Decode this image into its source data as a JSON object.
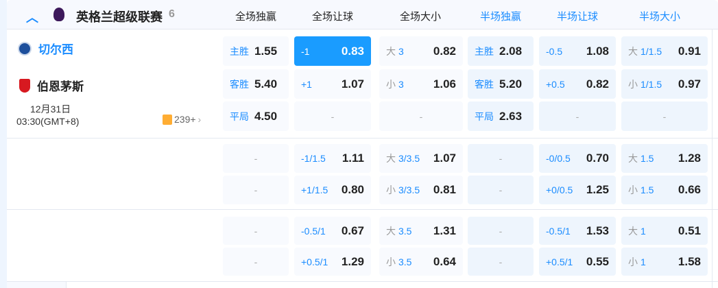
{
  "league": {
    "name": "英格兰超级联赛",
    "count": "6",
    "collapse_icon": "chevron-up-icon",
    "logo_icon": "premier-league-logo"
  },
  "columns": [
    "全场独赢",
    "全场让球",
    "全场大小",
    "半场独赢",
    "半场让球",
    "半场大小"
  ],
  "match": {
    "home": "切尔西",
    "away": "伯恩茅斯",
    "date": "12月31日",
    "time": "03:30(GMT+8)",
    "more_markets": "239+"
  },
  "colors": {
    "accent": "#1a8cff",
    "active": "#1a9cff"
  },
  "sections": [
    [
      [
        {
          "l": "主胜",
          "o": "1.55"
        },
        {
          "l": "-1",
          "o": "0.83",
          "active": true
        },
        {
          "p": "大",
          "l": "3",
          "o": "0.82"
        },
        {
          "l": "主胜",
          "o": "2.08"
        },
        {
          "l": "-0.5",
          "o": "1.08"
        },
        {
          "p": "大",
          "l": "1/1.5",
          "o": "0.91"
        }
      ],
      [
        {
          "l": "客胜",
          "o": "5.40"
        },
        {
          "l": "+1",
          "o": "1.07"
        },
        {
          "p": "小",
          "l": "3",
          "o": "1.06"
        },
        {
          "l": "客胜",
          "o": "5.20"
        },
        {
          "l": "+0.5",
          "o": "0.82"
        },
        {
          "p": "小",
          "l": "1/1.5",
          "o": "0.97"
        }
      ],
      [
        {
          "l": "平局",
          "o": "4.50"
        },
        {
          "e": "-"
        },
        {
          "e": "-"
        },
        {
          "l": "平局",
          "o": "2.63"
        },
        {
          "e": "-"
        },
        {
          "e": "-"
        }
      ]
    ],
    [
      [
        {
          "e": "-"
        },
        {
          "l": "-1/1.5",
          "o": "1.11"
        },
        {
          "p": "大",
          "l": "3/3.5",
          "o": "1.07"
        },
        {
          "e": "-"
        },
        {
          "l": "-0/0.5",
          "o": "0.70"
        },
        {
          "p": "大",
          "l": "1.5",
          "o": "1.28"
        }
      ],
      [
        {
          "e": "-"
        },
        {
          "l": "+1/1.5",
          "o": "0.80"
        },
        {
          "p": "小",
          "l": "3/3.5",
          "o": "0.81"
        },
        {
          "e": "-"
        },
        {
          "l": "+0/0.5",
          "o": "1.25"
        },
        {
          "p": "小",
          "l": "1.5",
          "o": "0.66"
        }
      ]
    ],
    [
      [
        {
          "e": "-"
        },
        {
          "l": "-0.5/1",
          "o": "0.67"
        },
        {
          "p": "大",
          "l": "3.5",
          "o": "1.31"
        },
        {
          "e": "-"
        },
        {
          "l": "-0.5/1",
          "o": "1.53"
        },
        {
          "p": "大",
          "l": "1",
          "o": "0.51"
        }
      ],
      [
        {
          "e": "-"
        },
        {
          "l": "+0.5/1",
          "o": "1.29"
        },
        {
          "p": "小",
          "l": "3.5",
          "o": "0.64"
        },
        {
          "e": "-"
        },
        {
          "l": "+0.5/1",
          "o": "0.55"
        },
        {
          "p": "小",
          "l": "1",
          "o": "1.58"
        }
      ]
    ]
  ]
}
